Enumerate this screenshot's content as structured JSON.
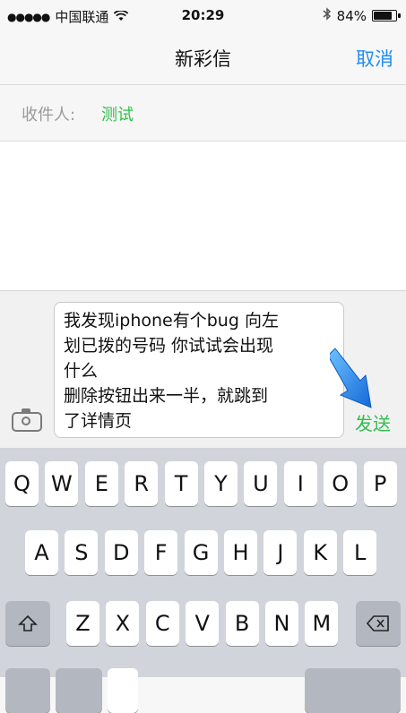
{
  "status_bar": {
    "signal": "●●●●●",
    "carrier": "中国联通",
    "wifi_icon": "wifi-icon",
    "time": "20:29",
    "bluetooth_icon": "bluetooth-icon",
    "battery_percent": "84%",
    "battery_level": 0.84
  },
  "nav": {
    "title": "新彩信",
    "cancel": "取消"
  },
  "recipient": {
    "label": "收件人:",
    "name": "测试"
  },
  "compose": {
    "message": "我发现iphone有个bug 向左\n划已拨的号码 你试试会出现\n什么\n删除按钮出来一半，就跳到\n了详情页",
    "send": "发送",
    "camera_icon": "camera-icon",
    "annotation_arrow": "arrow-icon",
    "accent_color": "#2fbf4b"
  },
  "keyboard": {
    "row1": [
      "Q",
      "W",
      "E",
      "R",
      "T",
      "Y",
      "U",
      "I",
      "O",
      "P"
    ],
    "row2": [
      "A",
      "S",
      "D",
      "F",
      "G",
      "H",
      "J",
      "K",
      "L"
    ],
    "row3": [
      "Z",
      "X",
      "C",
      "V",
      "B",
      "N",
      "M"
    ],
    "shift_icon": "shift-icon",
    "delete_icon": "backspace-icon"
  }
}
